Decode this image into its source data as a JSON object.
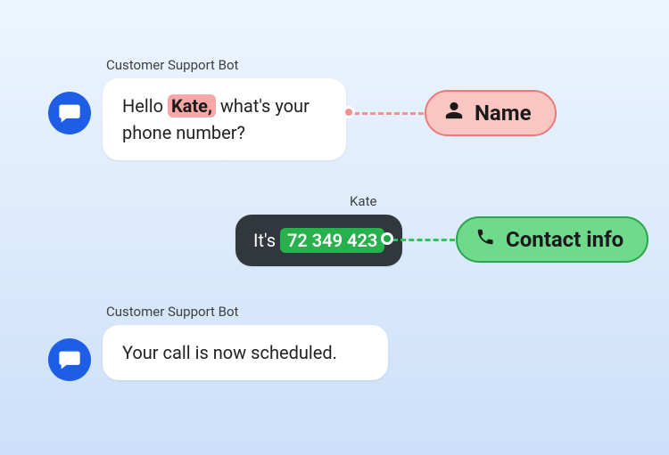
{
  "bot_name": "Customer Support Bot",
  "user_name": "Kate",
  "messages": {
    "bot1": {
      "pre": "Hello ",
      "highlight": "Kate,",
      "mid": " ",
      "post": "what's your phone number?"
    },
    "user1": {
      "pre": "It's ",
      "highlight": "72 349 423"
    },
    "bot2": {
      "text": "Your call is now scheduled."
    }
  },
  "annotations": {
    "name_label": "Name",
    "contact_label": "Contact info"
  },
  "highlight_colors": {
    "name": "#f7a7a7",
    "contact": "#26b14c"
  },
  "pill_colors": {
    "name_bg": "#f9c6c2",
    "name_border": "#ed7a7a",
    "contact_bg": "#6fd98c",
    "contact_border": "#2aa64c"
  }
}
